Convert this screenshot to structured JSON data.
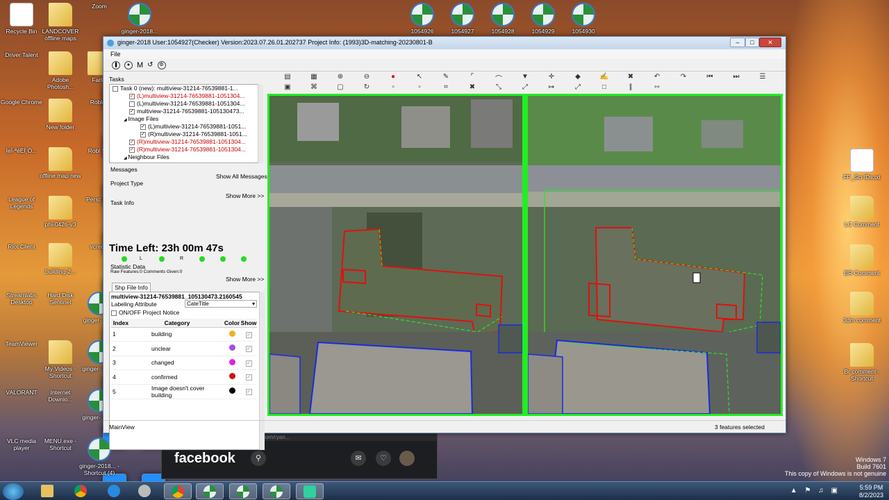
{
  "desktop": {
    "icons": [
      {
        "label": "Recycle Bin",
        "type": "doc"
      },
      {
        "label": "LANDCOVER offline maps",
        "type": "folder"
      },
      {
        "label": "Zoom",
        "type": "app"
      },
      {
        "label": "ginger-2018...",
        "type": "globe"
      },
      {
        "label": "Driver Talent",
        "type": "app"
      },
      {
        "label": "Adobe Photosh...",
        "type": "folder"
      },
      {
        "label": "Farlig",
        "type": "folder"
      },
      {
        "label": "Google Chrome",
        "type": "app"
      },
      {
        "label": "New folder",
        "type": "folder"
      },
      {
        "label": "Roblox",
        "type": "app"
      },
      {
        "label": "ÌeÌ-ªéËÍ¸Ò...",
        "type": "app"
      },
      {
        "label": "offline map new",
        "type": "folder"
      },
      {
        "label": "Robl Stu",
        "type": "app"
      },
      {
        "label": "League of Legends",
        "type": "app"
      },
      {
        "label": "phi-0426-v3",
        "type": "folder"
      },
      {
        "label": "Persc Chr",
        "type": "app"
      },
      {
        "label": "Riot Client",
        "type": "app"
      },
      {
        "label": "building-2...",
        "type": "folder"
      },
      {
        "label": "vcredis",
        "type": "app"
      },
      {
        "label": "Streamlabs Desktop",
        "type": "app"
      },
      {
        "label": "Hard Disk Sentinel",
        "type": "app"
      },
      {
        "label": "ginger- Shor",
        "type": "globe"
      },
      {
        "label": "TeamViewer",
        "type": "app"
      },
      {
        "label": "My Videos - Shortcut",
        "type": "folder"
      },
      {
        "label": "ginger- Short",
        "type": "globe"
      },
      {
        "label": "VALORANT",
        "type": "app"
      },
      {
        "label": "Internet Downlo...",
        "type": "app"
      },
      {
        "label": "ginger- Short",
        "type": "globe"
      },
      {
        "label": "VLC media player",
        "type": "app"
      },
      {
        "label": "MENU.exe - Shortcut",
        "type": "app"
      },
      {
        "label": "ginger-2018... - Shortcut (4)",
        "type": "globe"
      }
    ],
    "top_icons": [
      "1054926",
      "1054927",
      "1054928",
      "1054929",
      "1054930"
    ],
    "right_icons": [
      "FP_Sci IDs.txt",
      "LC Comment",
      "BR Comment",
      "3dm comment",
      "Br comment - Shortcut"
    ]
  },
  "app": {
    "title": "ginger-2018   User:1054927(Checker)   Version:2023.07.26.01.202737   Project Info: (1993)3D-matching-20230801-B",
    "menu_file": "File",
    "toolbar_m": "M",
    "tasks_label": "Tasks",
    "tree": [
      {
        "text": "Task 0 (new): multiview-31214-76539881-1...",
        "checked": false,
        "indent": 4,
        "red": false
      },
      {
        "text": "(L)multiview-31214-76539881-1051304...",
        "checked": true,
        "indent": 28,
        "red": true
      },
      {
        "text": "(L)multiview-31214-76539881-1051304...",
        "checked": false,
        "indent": 28,
        "red": false
      },
      {
        "text": "multiview-31214-76539881-105130473...",
        "checked": true,
        "indent": 28,
        "red": false
      },
      {
        "text": "Image Files",
        "checked": null,
        "indent": 20,
        "red": false
      },
      {
        "text": "(L)multiview-31214-76539881-1051...",
        "checked": true,
        "indent": 44,
        "red": false
      },
      {
        "text": "(R)multiview-31214-76539881-1051...",
        "checked": true,
        "indent": 44,
        "red": false
      },
      {
        "text": "(R)multiview-31214-76539881-1051304...",
        "checked": true,
        "indent": 28,
        "red": true
      },
      {
        "text": "(R)multiview-31214-76539881-1051304...",
        "checked": true,
        "indent": 28,
        "red": true
      },
      {
        "text": "Neighbour Files",
        "checked": null,
        "indent": 20,
        "red": false
      }
    ],
    "messages_label": "Messages",
    "show_all_messages": "Show All Messages",
    "project_type_label": "Project Type",
    "show_more_1": "Show More >>",
    "task_info_label": "Task Info",
    "time_left": "Time Left: 23h 00m 47s",
    "dot_labels": [
      "L",
      "R"
    ],
    "statistic_label": "Statistic Data",
    "raw_features": "Raw Features:0 Comments Given:0",
    "show_more_2": "Show More >>",
    "shp_tab": "Shp File Info",
    "shp_filename": "multiview-31214-76539881_105130473.2160545",
    "labeling_attribute": "Labeling Attribute",
    "labeling_value": "CateTitle",
    "onoff_notice": "ON/OFF Project Notice",
    "table_headers": {
      "index": "Index",
      "category": "Category",
      "color": "Color",
      "show": "Show"
    },
    "categories": [
      {
        "index": "1",
        "name": "building",
        "color": "#f0b020"
      },
      {
        "index": "2",
        "name": "unclear",
        "color": "#a050e0"
      },
      {
        "index": "3",
        "name": "changed",
        "color": "#e020e0"
      },
      {
        "index": "4",
        "name": "confirmed",
        "color": "#d01010"
      },
      {
        "index": "5",
        "name": "Image doesn't cover building",
        "color": "#000000"
      }
    ],
    "status_left": "MainView",
    "status_right": "3 features selected"
  },
  "facebook": {
    "logo": "facebook",
    "url": "facebook.com/ryan..."
  },
  "taskbar": {
    "time": "5:59 PM",
    "date": "8/2/2023",
    "notice_line1": "Windows 7",
    "notice_line2": "Build 7601",
    "notice_line3": "This copy of Windows is not genuine"
  },
  "colors": {
    "viewer_border": "#22ee22",
    "outline_red": "#e01010",
    "outline_blue": "#1a2ae0",
    "outline_green": "#30e030"
  }
}
